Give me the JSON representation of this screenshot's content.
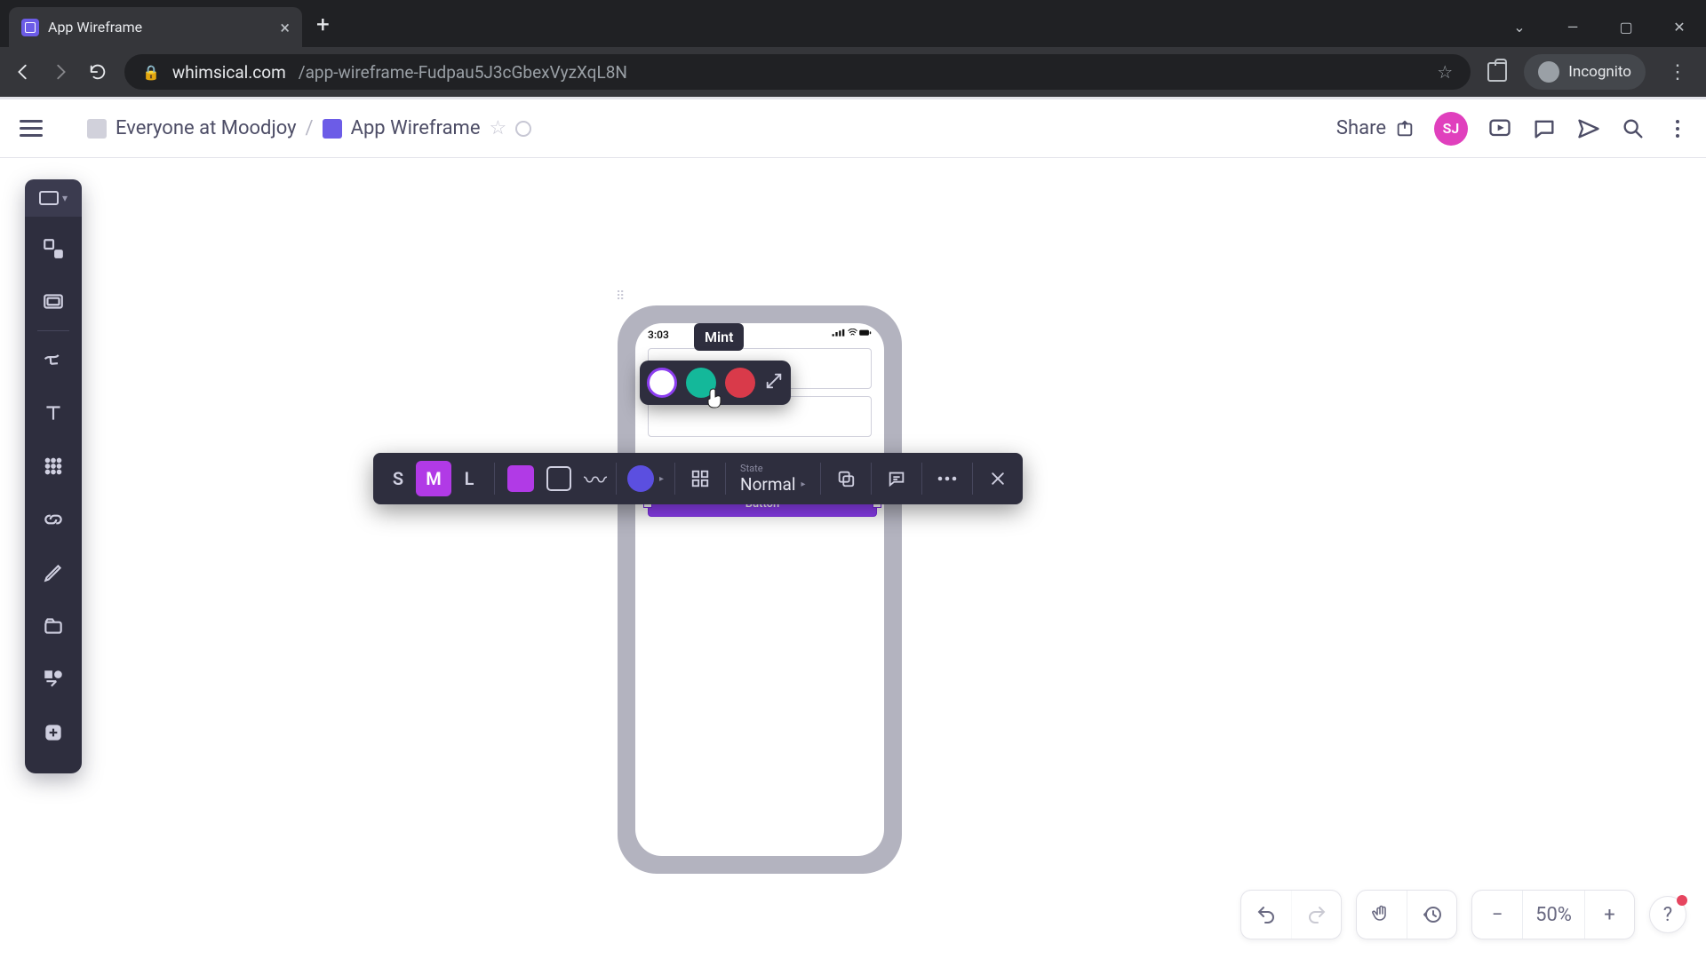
{
  "browser": {
    "tab_title": "App Wireframe",
    "url_host": "whimsical.com",
    "url_path": "/app-wireframe-Fudpau5J3cGbexVyzXqL8N",
    "incognito_label": "Incognito"
  },
  "topbar": {
    "org": "Everyone at Moodjoy",
    "doc": "App Wireframe",
    "share": "Share",
    "avatar_initials": "SJ"
  },
  "canvas": {
    "phone": {
      "time": "3:03",
      "button_label": "Button"
    }
  },
  "popover": {
    "tooltip": "Mint"
  },
  "float_toolbar": {
    "sizes": [
      "S",
      "M",
      "L"
    ],
    "active_size": "M",
    "state_label": "State",
    "state_value": "Normal"
  },
  "bottom": {
    "zoom": "50%"
  }
}
